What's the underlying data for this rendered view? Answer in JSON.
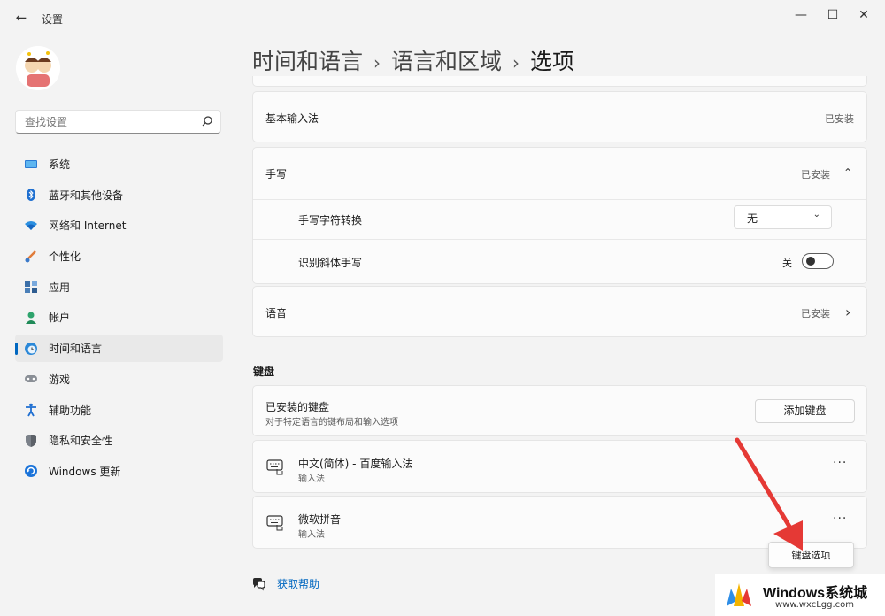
{
  "window": {
    "app_title": "设置",
    "back_icon": "←",
    "minimize_icon": "—",
    "maximize_icon": "☐",
    "close_icon": "✕"
  },
  "search": {
    "placeholder": "查找设置"
  },
  "sidebar": {
    "items": [
      {
        "label": "系统",
        "icon": "monitor-icon"
      },
      {
        "label": "蓝牙和其他设备",
        "icon": "bluetooth-icon"
      },
      {
        "label": "网络和 Internet",
        "icon": "wifi-icon"
      },
      {
        "label": "个性化",
        "icon": "brush-icon"
      },
      {
        "label": "应用",
        "icon": "apps-icon"
      },
      {
        "label": "帐户",
        "icon": "person-icon"
      },
      {
        "label": "时间和语言",
        "icon": "globe-clock-icon",
        "active": true
      },
      {
        "label": "游戏",
        "icon": "gamepad-icon"
      },
      {
        "label": "辅助功能",
        "icon": "accessibility-icon"
      },
      {
        "label": "隐私和安全性",
        "icon": "shield-icon"
      },
      {
        "label": "Windows 更新",
        "icon": "update-icon"
      }
    ]
  },
  "breadcrumb": {
    "level1": "时间和语言",
    "level2": "语言和区域",
    "current": "选项",
    "separator": "›"
  },
  "content": {
    "basic_input": {
      "title": "基本输入法",
      "status": "已安装"
    },
    "handwriting": {
      "title": "手写",
      "status": "已安装",
      "chevron": "⌃",
      "conversion_label": "手写字符转换",
      "conversion_value": "无",
      "italic_label": "识别斜体手写",
      "italic_state": "关"
    },
    "speech": {
      "title": "语音",
      "status": "已安装",
      "chevron": "›"
    },
    "keyboard_section": "键盘",
    "installed_keyboards": {
      "title": "已安装的键盘",
      "subtitle": "对于特定语言的键布局和输入选项",
      "add_button": "添加键盘"
    },
    "keyboards": [
      {
        "name": "中文(简体) - 百度输入法",
        "type": "输入法",
        "more": "···"
      },
      {
        "name": "微软拼音",
        "type": "输入法",
        "more": "···"
      }
    ],
    "keyboard_options_button": "键盘选项",
    "help_link": "获取帮助"
  },
  "watermark": {
    "title": "Windows系统城",
    "url": "www.wxcLgg.com"
  },
  "colors": {
    "accent": "#0067c0",
    "arrow": "#e53935"
  }
}
